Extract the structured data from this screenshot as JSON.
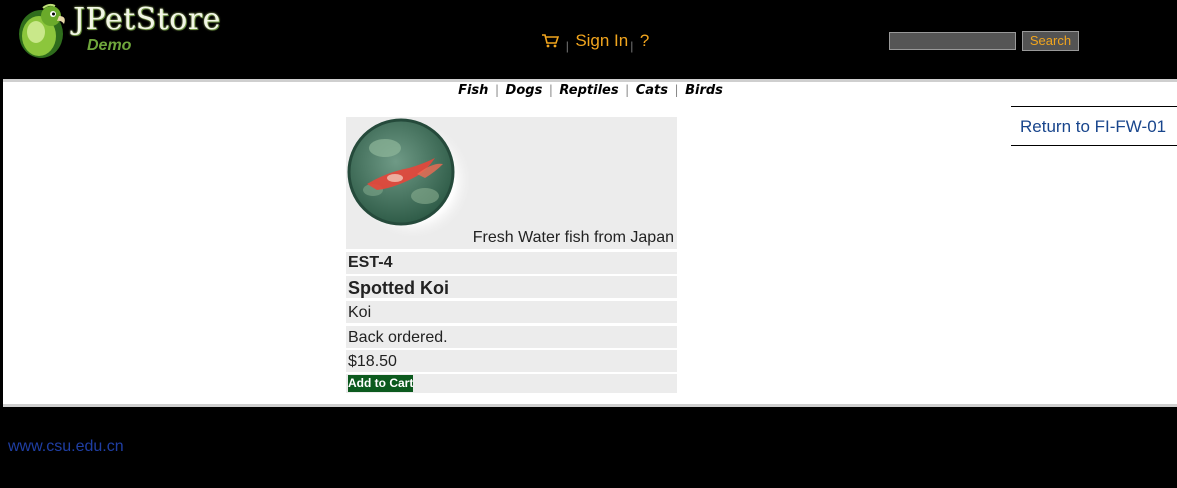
{
  "header": {
    "logo": {
      "title": "JPetStore",
      "subtitle": "Demo",
      "icon": "parrot-logo"
    },
    "menu": {
      "cart_icon": "shopping-cart-icon",
      "sep": "|",
      "sign_in": "Sign In",
      "help": "?"
    },
    "search": {
      "value": "",
      "button_label": "Search"
    }
  },
  "nav": {
    "categories": [
      "Fish",
      "Dogs",
      "Reptiles",
      "Cats",
      "Birds"
    ],
    "sep": "|"
  },
  "return_link": "Return to FI-FW-01",
  "product": {
    "image": "koi-fish-image",
    "description": "Fresh Water fish from Japan",
    "item_id": "EST-4",
    "name": "Spotted Koi",
    "product_name": "Koi",
    "stock": "Back ordered.",
    "price": "$18.50",
    "add_to_cart": "Add to Cart"
  },
  "footer": {
    "link": "www.csu.edu.cn"
  },
  "colors": {
    "header_bg": "#000000",
    "menu_link": "#f1a51e",
    "logo_green": "#6fa63c",
    "row_bg": "#ececec",
    "cart_button": "#0c5a1e",
    "return_link": "#18458c",
    "footer_link": "#1f3ea3"
  }
}
